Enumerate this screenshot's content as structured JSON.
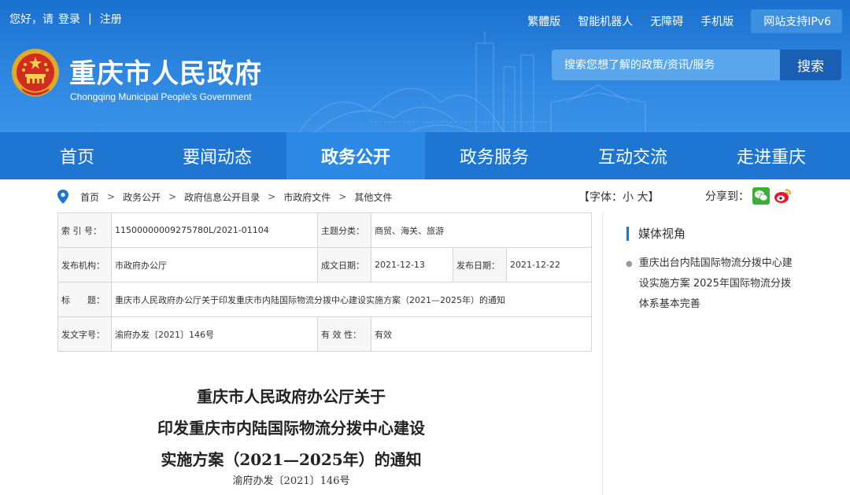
{
  "topbar": {
    "greeting": "您好，请",
    "login": "登录",
    "register": "注册",
    "links": [
      "繁體版",
      "智能机器人",
      "无障碍",
      "手机版"
    ],
    "ipv6": "网站支持IPv6"
  },
  "site": {
    "title_cn": "重庆市人民政府",
    "title_en": "Chongqing Municipal People’s Government"
  },
  "search": {
    "placeholder": "搜索您想了解的政策/资讯/服务",
    "button": "搜索"
  },
  "nav": {
    "items": [
      "首页",
      "要闻动态",
      "政务公开",
      "政务服务",
      "互动交流",
      "走进重庆"
    ],
    "active_index": 2
  },
  "breadcrumb": {
    "items": [
      "首页",
      "政务公开",
      "政府信息公开目录",
      "市政府文件",
      "其他文件"
    ]
  },
  "font_control": "【字体：小 大】",
  "share": {
    "label": "分享到："
  },
  "info_table": {
    "index_label": "索 引 号：",
    "index_value": "11500000009275780L/2021-01104",
    "topic_label": "主题分类：",
    "topic_value": "商贸、海关、旅游",
    "publisher_label": "发布机构：",
    "publisher_value": "市政府办公厅",
    "written_label": "成文日期：",
    "written_value": "2021-12-13",
    "release_label": "发布日期：",
    "release_value": "2021-12-22",
    "title_label": "标　　题：",
    "title_value": "重庆市人民政府办公厅关于印发重庆市内陆国际物流分拨中心建设实施方案（2021—2025年）的通知",
    "docno_label": "发文字号：",
    "docno_value": "渝府办发〔2021〕146号",
    "validity_label": "有 效 性：",
    "validity_value": "有效"
  },
  "sidebar": {
    "title": "媒体视角",
    "items": [
      "重庆出台内陆国际物流分拨中心建设实施方案 2025年国际物流分拨体系基本完善"
    ]
  },
  "document": {
    "title_line1": "重庆市人民政府办公厅关于",
    "title_line2": "印发重庆市内陆国际物流分拨中心建设",
    "title_line3": "实施方案（2021—2025年）的通知",
    "doc_number": "渝府办发〔2021〕146号"
  },
  "colors": {
    "header_blue": "#1a70cf",
    "nav_blue": "#1e76d2",
    "nav_active": "#2b88e4",
    "search_button": "#1a5fb4"
  }
}
